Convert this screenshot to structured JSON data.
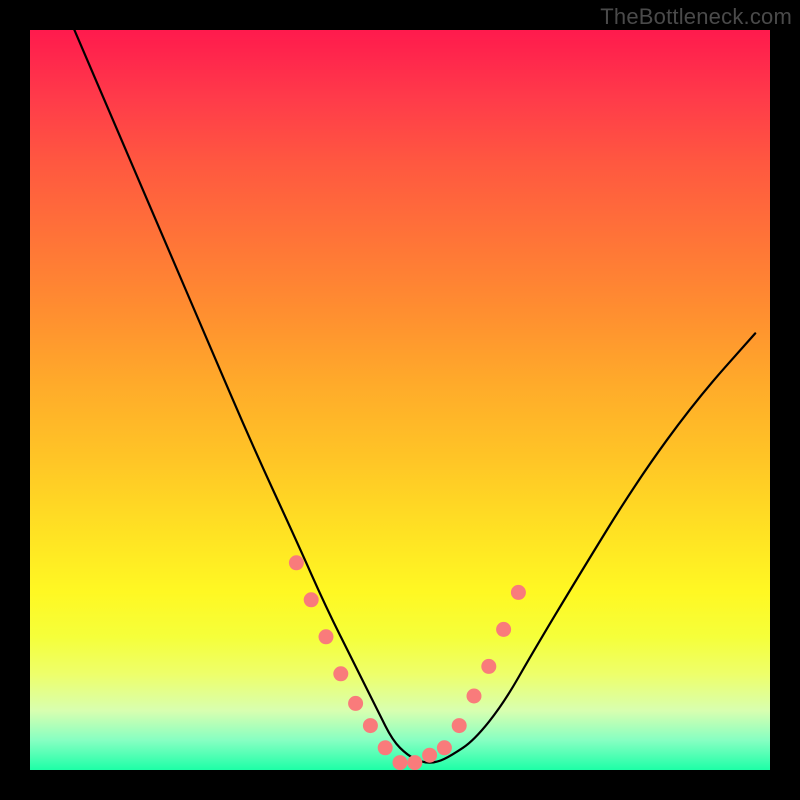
{
  "watermark": "TheBottleneck.com",
  "chart_data": {
    "type": "line",
    "title": "",
    "xlabel": "",
    "ylabel": "",
    "xlim": [
      0,
      100
    ],
    "ylim": [
      0,
      100
    ],
    "grid": false,
    "legend": false,
    "series": [
      {
        "name": "bottleneck-curve",
        "color": "#000000",
        "x": [
          6,
          12,
          18,
          24,
          30,
          36,
          40,
          44,
          47,
          49,
          51,
          53,
          55,
          57,
          60,
          64,
          68,
          74,
          82,
          90,
          98
        ],
        "values": [
          100,
          86,
          72,
          58,
          44,
          31,
          22,
          14,
          8,
          4,
          2,
          1,
          1,
          2,
          4,
          9,
          16,
          26,
          39,
          50,
          59
        ]
      }
    ],
    "markers": {
      "name": "highlight-dots",
      "color": "#f97b7b",
      "x": [
        36,
        38,
        40,
        42,
        44,
        46,
        48,
        50,
        52,
        54,
        56,
        58,
        60,
        62,
        64,
        66
      ],
      "values": [
        28,
        23,
        18,
        13,
        9,
        6,
        3,
        1,
        1,
        2,
        3,
        6,
        10,
        14,
        19,
        24
      ]
    },
    "background_gradient": {
      "top": "#ff1a4d",
      "mid": "#ffe223",
      "bottom": "#1dffa7"
    }
  }
}
